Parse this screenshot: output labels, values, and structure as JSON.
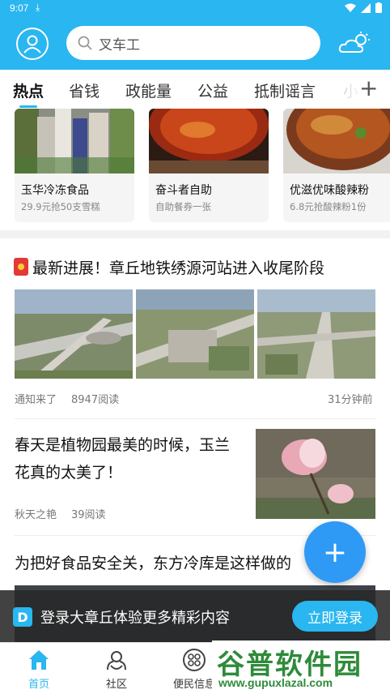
{
  "status_bar": {
    "time": "9:07",
    "download_icon": "download-icon",
    "icons": [
      "wifi-icon",
      "signal-icon",
      "battery-icon"
    ]
  },
  "header": {
    "search_placeholder": "叉车工",
    "icons": [
      "avatar-icon",
      "search-icon",
      "weather-icon"
    ]
  },
  "tabs": [
    {
      "label": "热点",
      "active": true
    },
    {
      "label": "省钱"
    },
    {
      "label": "政能量"
    },
    {
      "label": "公益"
    },
    {
      "label": "抵制谣言"
    },
    {
      "label": "小"
    }
  ],
  "tabs_more": "+",
  "cards": [
    {
      "title": "玉华冷冻食品",
      "subtitle": "29.9元抢50支雪糕"
    },
    {
      "title": "奋斗者自助",
      "subtitle": "自助餐券一张"
    },
    {
      "title": "优滋优味酸辣粉",
      "subtitle": "6.8元抢酸辣粉1份"
    }
  ],
  "articles": [
    {
      "title": "最新进展！章丘地铁绣源河站进入收尾阶段",
      "source": "通知来了",
      "reads": "8947阅读",
      "time": "31分钟前"
    },
    {
      "title": "春天是植物园最美的时候，玉兰花真的太美了！",
      "source": "秋天之艳",
      "reads": "39阅读"
    },
    {
      "title": "为把好食品安全关，东方冷库是这样做的"
    }
  ],
  "fab": "+",
  "login_banner": {
    "logo": "D",
    "text": "登录大章丘体验更多精彩内容",
    "button": "立即登录"
  },
  "bottom_nav": [
    {
      "label": "首页",
      "icon": "home-icon",
      "active": true
    },
    {
      "label": "社区",
      "icon": "community-icon"
    },
    {
      "label": "便民信息",
      "icon": "services-icon"
    }
  ],
  "watermark": {
    "text": "谷普软件园",
    "url": "www.gupuxlazal.com"
  },
  "colors": {
    "accent": "#2ab6f0",
    "fab": "#2f9af5",
    "watermark": "#2e8b3a"
  }
}
